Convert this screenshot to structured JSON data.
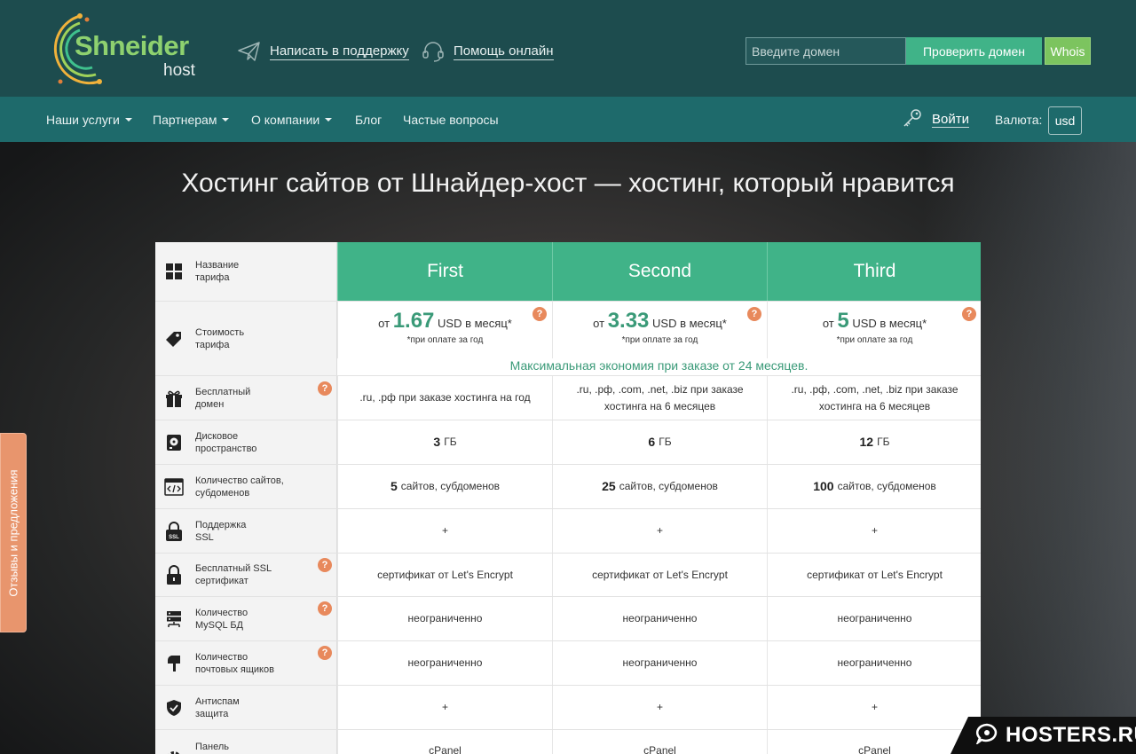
{
  "header": {
    "logo_name": "Shneider",
    "logo_sub": "host",
    "support_link": "Написать в поддержку",
    "help_link": "Помощь онлайн",
    "domain_placeholder": "Введите домен",
    "check_button": "Проверить домен",
    "whois_button": "Whois"
  },
  "nav": {
    "items": [
      "Наши услуги",
      "Партнерам",
      "О компании",
      "Блог",
      "Частые вопросы"
    ],
    "login": "Войти",
    "currency_label": "Валюта:",
    "currency_value": "usd"
  },
  "page_title": "Хостинг сайтов от Шнайдер-хост — хостинг, который нравится",
  "side_tab": "Отзывы и предложения",
  "table": {
    "plan_name_label": "Название тарифа",
    "plans": [
      "First",
      "Second",
      "Third"
    ],
    "price_label": "Стоимость тарифа",
    "price_prefix": "от",
    "prices": [
      "1.67",
      "3.33",
      "5"
    ],
    "price_suffix": "USD в месяц*",
    "price_note": "*при оплате за год",
    "promo": "Максимальная экономия при заказе от 24 месяцев.",
    "rows": [
      {
        "label": "Бесплатный домен",
        "values": [
          ".ru, .рф при заказе хостинга на год",
          ".ru, .рф, .com, .net, .biz при заказе хостинга на 6 месяцев",
          ".ru, .рф, .com, .net, .biz при заказе хостинга на 6 месяцев"
        ]
      },
      {
        "label": "Дисковое пространство",
        "nums": [
          "3",
          "6",
          "12"
        ],
        "unit": "ГБ"
      },
      {
        "label": "Количество сайтов, субдоменов",
        "nums": [
          "5",
          "25",
          "100"
        ],
        "unit": "сайтов, субдоменов"
      },
      {
        "label": "Поддержка SSL",
        "values": [
          "+",
          "+",
          "+"
        ]
      },
      {
        "label": "Бесплатный SSL сертификат",
        "values": [
          "сертификат от Let's Encrypt",
          "сертификат от Let's Encrypt",
          "сертификат от Let's Encrypt"
        ]
      },
      {
        "label": "Количество MySQL БД",
        "values": [
          "неограниченно",
          "неограниченно",
          "неограниченно"
        ]
      },
      {
        "label": "Количество почтовых ящиков",
        "values": [
          "неограниченно",
          "неограниченно",
          "неограниченно"
        ]
      },
      {
        "label": "Антиспам защита",
        "values": [
          "+",
          "+",
          "+"
        ]
      },
      {
        "label": "Панель",
        "values": [
          "cPanel",
          "cPanel",
          "cPanel"
        ]
      }
    ]
  },
  "question_mark": "?",
  "badge": "HOSTERS.RU",
  "colors": {
    "brand_green": "#40b388",
    "header_dark": "#1d4c4e",
    "nav_teal": "#1e6a6b",
    "accent_orange": "#e8895c"
  }
}
